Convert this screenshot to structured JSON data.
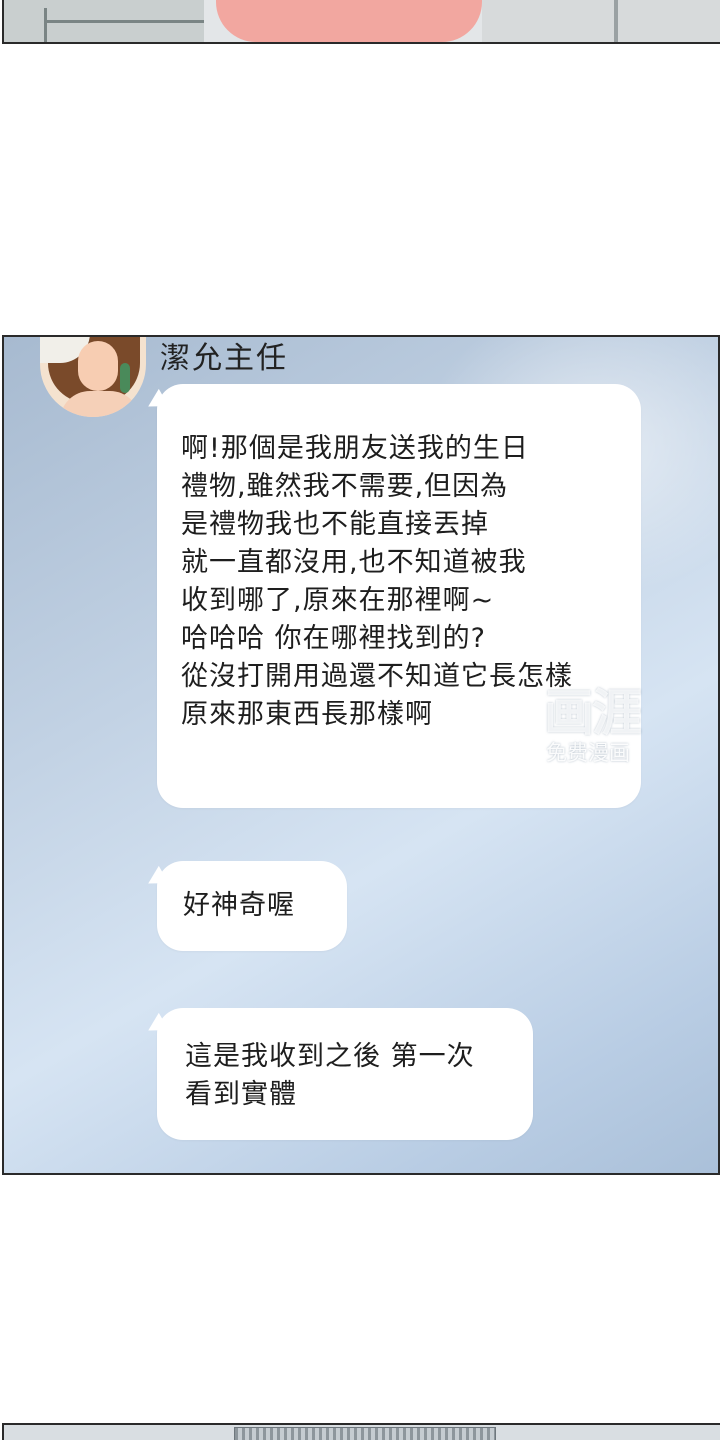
{
  "chat": {
    "contact_name": "潔允主任",
    "messages": [
      {
        "lines": [
          "啊!那個是我朋友送我的生日",
          "禮物,雖然我不需要,但因為",
          "是禮物我也不能直接丟掉",
          "就一直都沒用,也不知道被我",
          "收到哪了,原來在那裡啊~",
          "哈哈哈 你在哪裡找到的?",
          "從沒打開用過還不知道它長怎樣",
          "原來那東西長那樣啊"
        ]
      },
      {
        "lines": [
          "好神奇喔"
        ]
      },
      {
        "lines": [
          "這是我收到之後 第一次",
          "看到實體"
        ]
      }
    ]
  },
  "watermark": {
    "logo": "画涯",
    "caption": "免费漫画"
  }
}
